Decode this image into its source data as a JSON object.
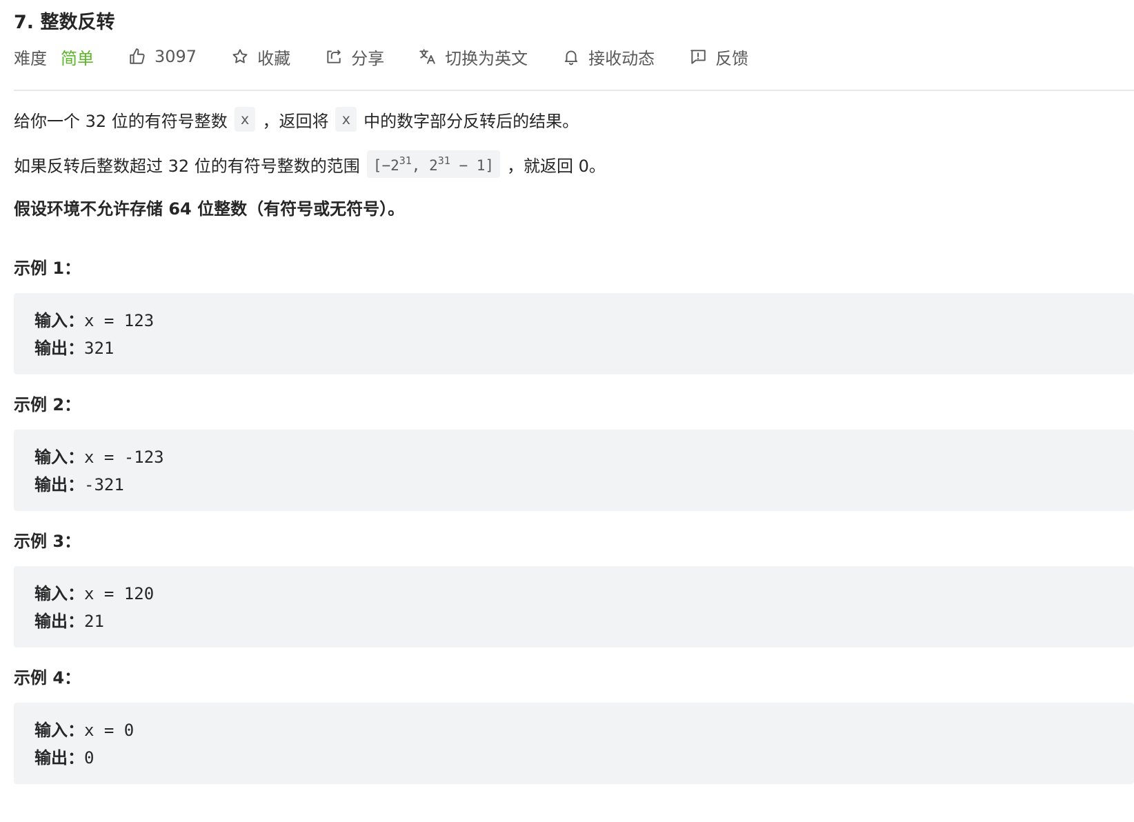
{
  "problem": {
    "title": "7. 整数反转",
    "difficulty_label": "难度",
    "difficulty_value": "简单",
    "likes": "3097",
    "favorite_label": "收藏",
    "share_label": "分享",
    "translate_label": "切换为英文",
    "subscribe_label": "接收动态",
    "feedback_label": "反馈"
  },
  "description": {
    "p1_a": "给你一个 32 位的有符号整数",
    "p1_code1": "x",
    "p1_b": "，返回将",
    "p1_code2": "x",
    "p1_c": "中的数字部分反转后的结果。",
    "p2_a": "如果反转后整数超过 32 位的有符号整数的范围",
    "p2_range_open": "[−2",
    "p2_exp1": "31",
    "p2_range_mid": ",  2",
    "p2_exp2": "31",
    "p2_range_close": " − 1]",
    "p2_b": "，就返回 0。",
    "p3": "假设环境不允许存储 64 位整数（有符号或无符号）。"
  },
  "examples": [
    {
      "title": "示例 1：",
      "input_key": "输入：",
      "input_val": "x = 123",
      "output_key": "输出：",
      "output_val": "321"
    },
    {
      "title": "示例 2：",
      "input_key": "输入：",
      "input_val": "x = -123",
      "output_key": "输出：",
      "output_val": "-321"
    },
    {
      "title": "示例 3：",
      "input_key": "输入：",
      "input_val": "x = 120",
      "output_key": "输出：",
      "output_val": "21"
    },
    {
      "title": "示例 4：",
      "input_key": "输入：",
      "input_val": "x = 0",
      "output_key": "输出：",
      "output_val": "0"
    }
  ],
  "colors": {
    "easy_green": "#5ab726",
    "code_bg": "#f2f3f5",
    "text": "#262626",
    "muted": "#595959"
  }
}
